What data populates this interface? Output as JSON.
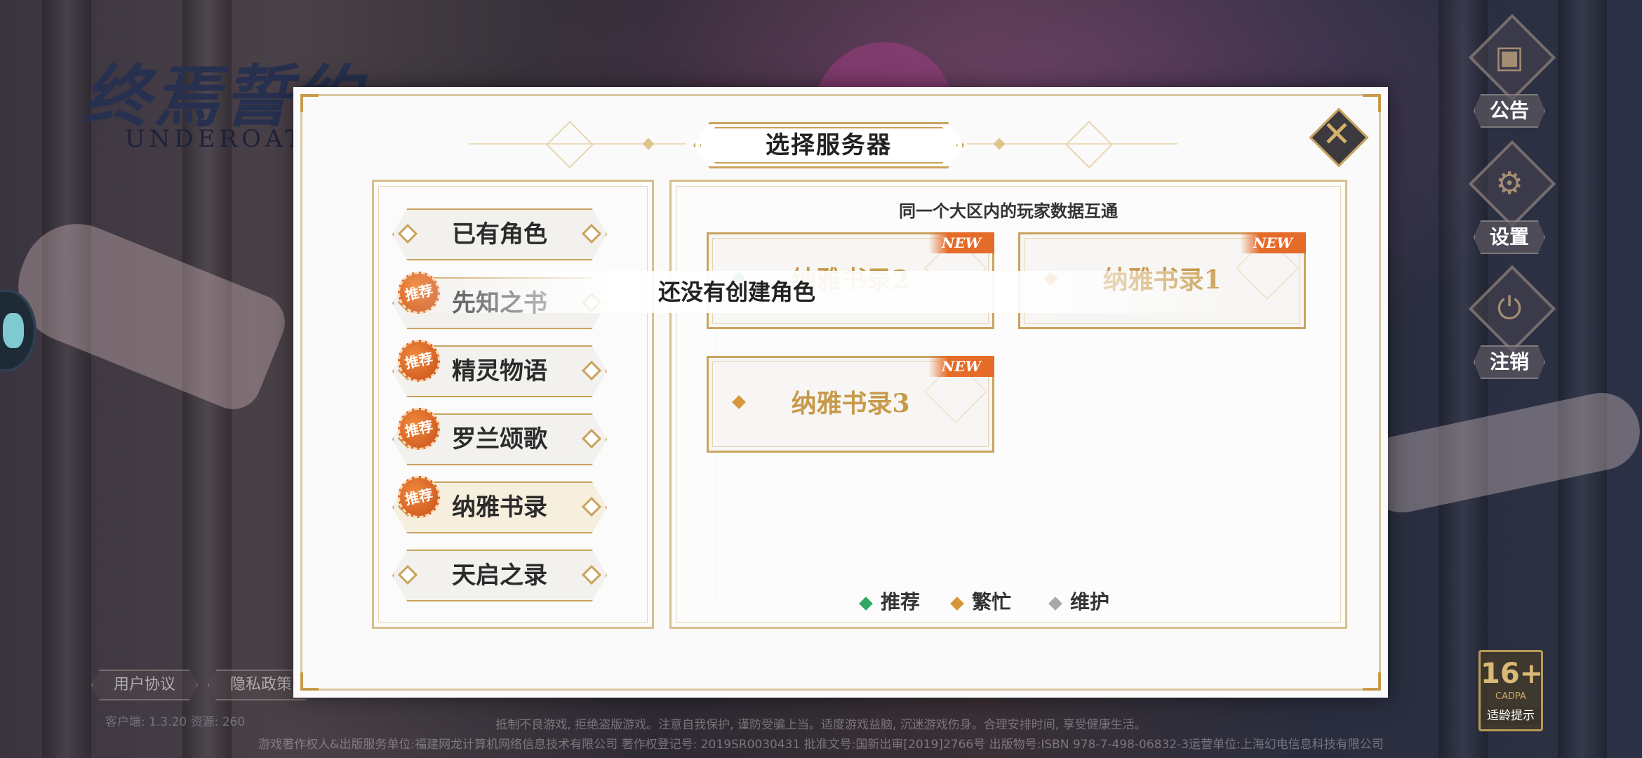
{
  "background": {
    "logo_title": "终焉誓约",
    "logo_sub": "UNDEROATH"
  },
  "side_buttons": [
    {
      "label": "公告",
      "icon": "announcement-icon",
      "glyph": "▣"
    },
    {
      "label": "设置",
      "icon": "gear-icon",
      "glyph": "⚙"
    },
    {
      "label": "注销",
      "icon": "power-icon",
      "glyph": "⏻"
    }
  ],
  "bottom_links": {
    "user_agreement": "用户协议",
    "privacy_policy": "隐私政策"
  },
  "version_text": "客户端: 1.3.20  资源: 260",
  "footer": {
    "line1": "抵制不良游戏, 拒绝盗版游戏。注意自我保护, 谨防受骗上当。适度游戏益脑, 沉迷游戏伤身。合理安排时间, 享受健康生活。",
    "line2": "游戏著作权人&出版服务单位:福建网龙计算机网络信息技术有限公司  著作权登记号: 2019SR0030431  批准文号:国新出审[2019]2766号  出版物号:ISBN 978-7-498-06832-3运营单位:上海幻电信息科技有限公司"
  },
  "age_rating": {
    "value": "16+",
    "org": "CADPA",
    "tip": "适龄提示"
  },
  "modal": {
    "title": "选择服务器",
    "close_icon": "close-icon",
    "hint": "同一个大区内的玩家数据互通",
    "regions": [
      {
        "label": "已有角色",
        "recommended": false,
        "selected": false
      },
      {
        "label": "先知之书",
        "recommended": true,
        "selected": false
      },
      {
        "label": "精灵物语",
        "recommended": true,
        "selected": false
      },
      {
        "label": "罗兰颂歌",
        "recommended": true,
        "selected": false
      },
      {
        "label": "纳雅书录",
        "recommended": true,
        "selected": true
      },
      {
        "label": "天启之录",
        "recommended": false,
        "selected": false
      }
    ],
    "recommend_badge": "推荐",
    "servers": [
      {
        "name": "纳雅书录2",
        "new": "NEW",
        "status": "recommended"
      },
      {
        "name": "纳雅书录1",
        "new": "NEW",
        "status": "busy"
      },
      {
        "name": "纳雅书录3",
        "new": "NEW",
        "status": "busy"
      }
    ],
    "legend": [
      {
        "label": "推荐",
        "color": "#2fa866"
      },
      {
        "label": "繁忙",
        "color": "#d9953a"
      },
      {
        "label": "维护",
        "color": "#a8a8a8"
      }
    ],
    "toast": "还没有创建角色"
  }
}
